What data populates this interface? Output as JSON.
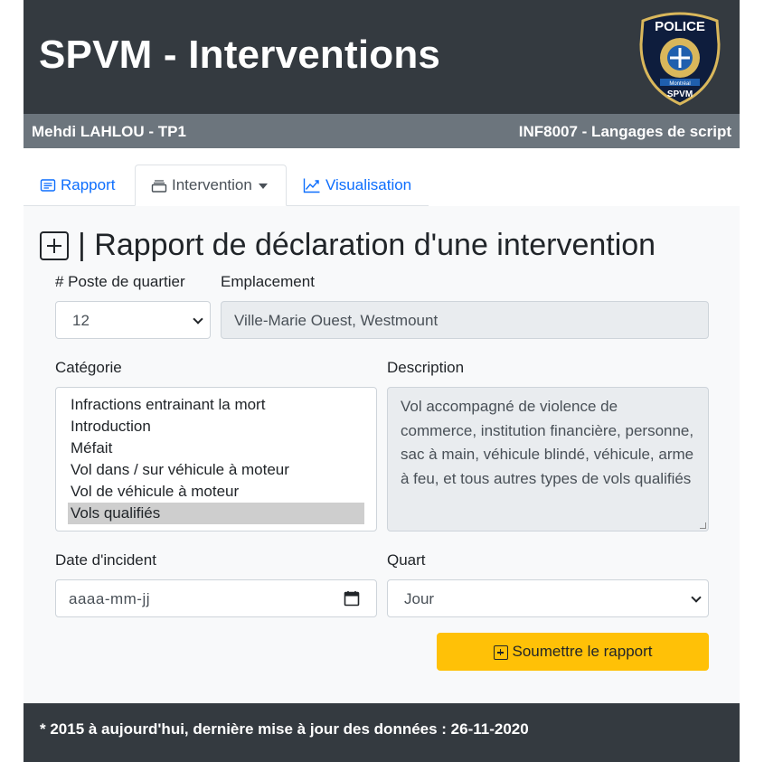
{
  "header": {
    "title": "SPVM - Interventions",
    "badge": {
      "top_text": "POLICE",
      "city_text": "Montréal",
      "bottom_text": "SPVM"
    }
  },
  "subbar": {
    "left": "Mehdi LAHLOU - TP1",
    "right": "INF8007 - Langages de script"
  },
  "tabs": [
    {
      "label": "Rapport",
      "icon": "report-icon",
      "active": false
    },
    {
      "label": "Intervention",
      "icon": "inbox-icon",
      "active": true
    },
    {
      "label": "Visualisation",
      "icon": "chart-line-icon",
      "active": false
    }
  ],
  "form": {
    "heading": "| Rapport de déclaration d'une intervention",
    "poste": {
      "label": "# Poste de quartier",
      "value": "12"
    },
    "emplacement": {
      "label": "Emplacement",
      "value": "Ville-Marie Ouest, Westmount"
    },
    "categorie": {
      "label": "Catégorie",
      "options": [
        "Infractions entrainant la mort",
        "Introduction",
        "Méfait",
        "Vol dans / sur véhicule à moteur",
        "Vol de véhicule à moteur",
        "Vols qualifiés"
      ],
      "selected": "Vols qualifiés"
    },
    "description": {
      "label": "Description",
      "value": "Vol accompagné de violence de commerce, institution financière, personne, sac à main, véhicule blindé, véhicule, arme à feu, et tous autres types de vols qualifiés"
    },
    "date": {
      "label": "Date d'incident",
      "placeholder": "aaaa-mm-jj"
    },
    "quart": {
      "label": "Quart",
      "value": "Jour"
    },
    "submit_label": "Soumettre le rapport"
  },
  "footer": {
    "text": "* 2015 à aujourd'hui, dernière mise à jour des données : 26-11-2020"
  },
  "colors": {
    "header_bg": "#343a40",
    "subbar_bg": "#6c757d",
    "link": "#0d6efd",
    "submit_bg": "#ffc107",
    "panel_bg": "#f8f9fa"
  }
}
